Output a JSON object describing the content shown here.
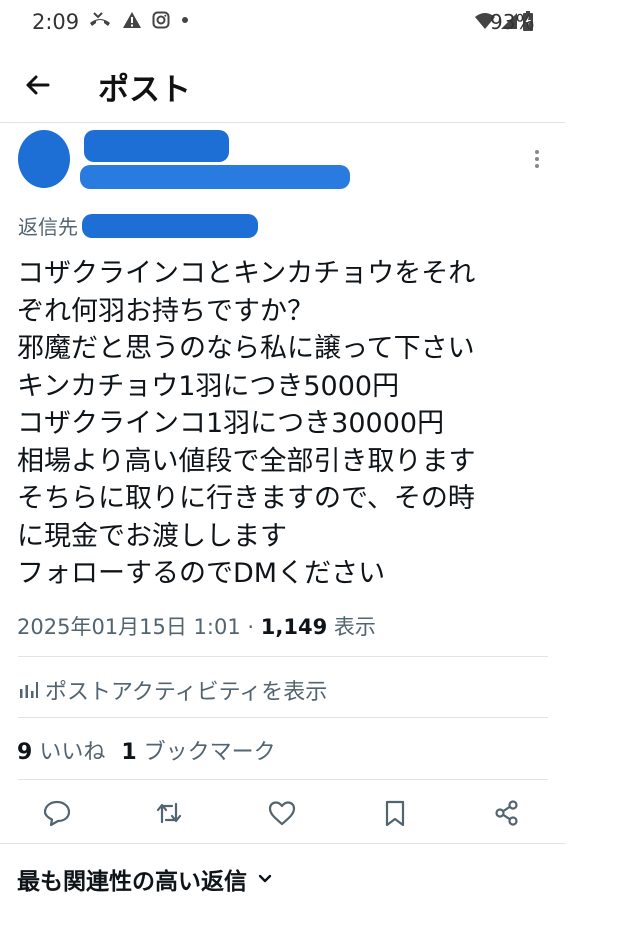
{
  "status_bar": {
    "time": "2:09",
    "battery": "93%",
    "icons_left": [
      "missed-call-icon",
      "warning-icon",
      "instagram-icon",
      "dot-icon"
    ],
    "icons_right": [
      "wifi-icon",
      "signal-icon",
      "battery-icon"
    ]
  },
  "header": {
    "title": "ポスト"
  },
  "post": {
    "reply_to_label": "返信先",
    "text_lines": [
      "コザクラインコとキンカチョウをそれ",
      "ぞれ何羽お持ちですか？",
      "邪魔だと思うのなら私に譲って下さい",
      "キンカチョウ1羽につき5000円",
      "コザクラインコ1羽につき30000円",
      "相場より高い値段で全部引き取ります",
      "そちらに取りに行きますので、その時",
      "に現金でお渡しします",
      "フォローするのでDMください"
    ],
    "timestamp": "2025年01月15日 1:01",
    "separator": "·",
    "views_count": "1,149",
    "views_label": "表示"
  },
  "activity": {
    "label": "ポストアクティビティを表示"
  },
  "engagement": {
    "likes_count": "9",
    "likes_label": "いいね",
    "bookmarks_count": "1",
    "bookmarks_label": "ブックマーク"
  },
  "replies_section": {
    "label": "最も関連性の高い返信"
  },
  "colors": {
    "redaction": "#1d6fd6",
    "secondary_text": "#536471",
    "divider": "#e1e4e6"
  }
}
